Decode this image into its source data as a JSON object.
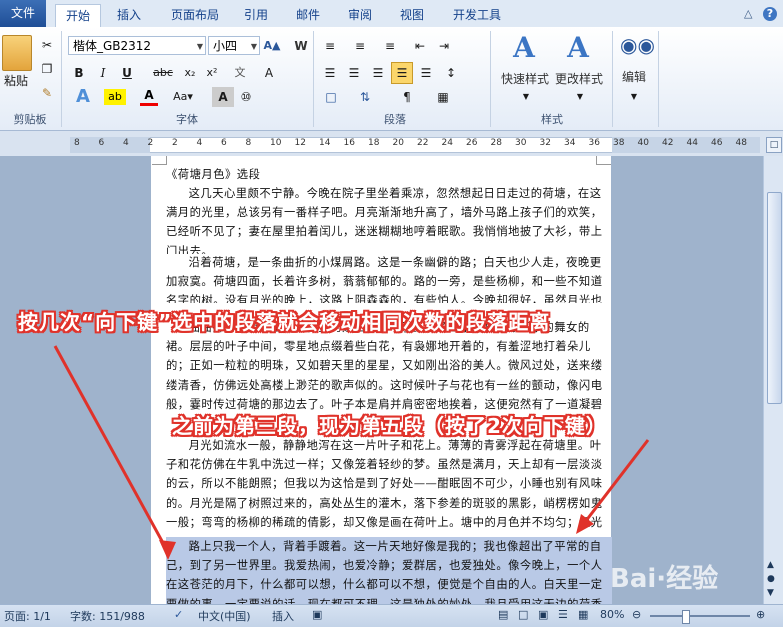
{
  "tabs": [
    "文件",
    "开始",
    "插入",
    "页面布局",
    "引用",
    "邮件",
    "审阅",
    "视图",
    "开发工具"
  ],
  "ribbon": {
    "paste_label": "粘贴",
    "font_name": "楷体_GB2312",
    "font_size": "小四",
    "styles": [
      "快速样式",
      "更改样式"
    ],
    "edit_label": "编辑",
    "groups": {
      "clipboard": "剪贴板",
      "font": "字体",
      "paragraph": "段落",
      "styles": "样式"
    }
  },
  "ruler_numbers": [
    "8",
    "6",
    "4",
    "2",
    "2",
    "4",
    "6",
    "8",
    "10",
    "12",
    "14",
    "16",
    "18",
    "20",
    "22",
    "24",
    "26",
    "28",
    "30",
    "32",
    "34",
    "36",
    "38",
    "40",
    "42",
    "44",
    "46",
    "48"
  ],
  "document": {
    "title_line": "《荷塘月色》选段",
    "p1": "这几天心里颇不宁静。今晚在院子里坐着乘凉，忽然想起日日走过的荷塘，在这满月的光里，总该另有一番样子吧。月亮渐渐地升高了，墙外马路上孩子们的欢笑，已经听不见了；妻在屋里拍着闰儿，迷迷糊糊地哼着眠歌。我悄悄地披了大衫，带上门出去。",
    "p2": "沿着荷塘，是一条曲折的小煤屑路。这是一条幽僻的路；白天也少人走，夜晚更加寂寞。荷塘四面，长着许多树，蓊蓊郁郁的。路的一旁，是些杨柳，和一些不知道名字的树。没有月光的晚上，这路上阴森森的，有些怕人。今晚却很好，虽然月光也还是淡淡的。",
    "p3": "曲曲折折的荷塘上面，弥望的是田田的叶子。叶子出水很高，像亭亭的舞女的裙。层层的叶子中间，零星地点缀着些白花，有袅娜地开着的，有羞涩地打着朵儿的；正如一粒粒的明珠，又如碧天里的星星，又如刚出浴的美人。微风过处，送来缕缕清香，仿佛远处高楼上渺茫的歌声似的。这时候叶子与花也有一丝的颤动，像闪电般，霎时传过荷塘的那边去了。叶子本是肩并肩密密地挨着，这便宛然有了一道凝碧的波痕。叶子底下是脉脉的流水，遮住了，不能见一些颜色；而叶子却更见风致了。",
    "p4": "月光如流水一般，静静地泻在这一片叶子和花上。薄薄的青雾浮起在荷塘里。叶子和花仿佛在牛乳中洗过一样；又像笼着轻纱的梦。虽然是满月，天上却有一层淡淡的云，所以不能朗照；但我以为这恰是到了好处——酣眠固不可少，小睡也别有风味的。月光是隔了树照过来的，高处丛生的灌木，落下参差的斑驳的黑影，峭楞楞如鬼一般；弯弯的杨柳的稀疏的倩影，却又像是画在荷叶上。塘中的月色并不均匀；但光与影有着和谐的旋律，如梵婀玲上奏着的名曲。",
    "p5": "路上只我一个人，背着手踱着。这一片天地好像是我的；我也像超出了平常的自己，到了另一世界里。我爱热闹，也爱冷静；爱群居，也爱独处。像今晚上，一个人在这苍茫的月下，什么都可以想，什么都可以不想，便觉是个自由的人。白天里一定要做的事，一定要说的话，现在都可不理。这是独处的妙处，我且受用这无边的荷香月色好了。"
  },
  "callouts": {
    "top": "按几次“向下键”选中的段落就会移动相同次数的段落距离",
    "middle": "之前为第三段，现为第五段（按了2次向下键）"
  },
  "watermark": "Bai·经验",
  "status": {
    "page": "页面: 1/1",
    "words": "字数: 151/988",
    "language": "中文(中国)",
    "mode": "插入",
    "zoom": "80%"
  },
  "colors": {
    "accent": "#2b579a",
    "callout": "#e0322a",
    "selection": "#b9c9e6"
  }
}
